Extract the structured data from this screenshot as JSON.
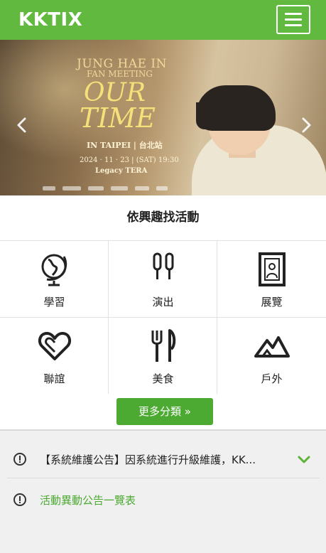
{
  "header": {
    "logo": "KKTIX",
    "menu_icon": "hamburger-menu-icon",
    "brand_color": "#62b93f"
  },
  "banner": {
    "line1": "JUNG HAE IN",
    "line2": "FAN MEETING",
    "title_line1": "OUR",
    "title_line2": "TIME",
    "city": "IN TAIPEI | 台北站",
    "date": "2024 · 11 · 23 | (SAT) 19:30",
    "venue": "Legacy TERA",
    "prev_icon": "chevron-left-icon",
    "next_icon": "chevron-right-icon"
  },
  "section_title": "依興趣找活動",
  "categories": [
    {
      "label": "學習",
      "icon": "globe-icon"
    },
    {
      "label": "演出",
      "icon": "microphone-icon"
    },
    {
      "label": "展覽",
      "icon": "picture-frame-icon"
    },
    {
      "label": "聯誼",
      "icon": "heart-icon"
    },
    {
      "label": "美食",
      "icon": "fork-knife-icon"
    },
    {
      "label": "戶外",
      "icon": "mountain-icon"
    }
  ],
  "more_button": "更多分類 »",
  "notices": [
    {
      "text": "【系統維護公告】因系統進行升級維護，KK...",
      "icon": "alert-circle-icon",
      "action_icon": "chevron-down-icon"
    },
    {
      "text": "活動異動公告一覽表",
      "icon": "alert-circle-icon"
    }
  ],
  "colors": {
    "accent": "#4caa32",
    "chevron": "#5cb338"
  }
}
